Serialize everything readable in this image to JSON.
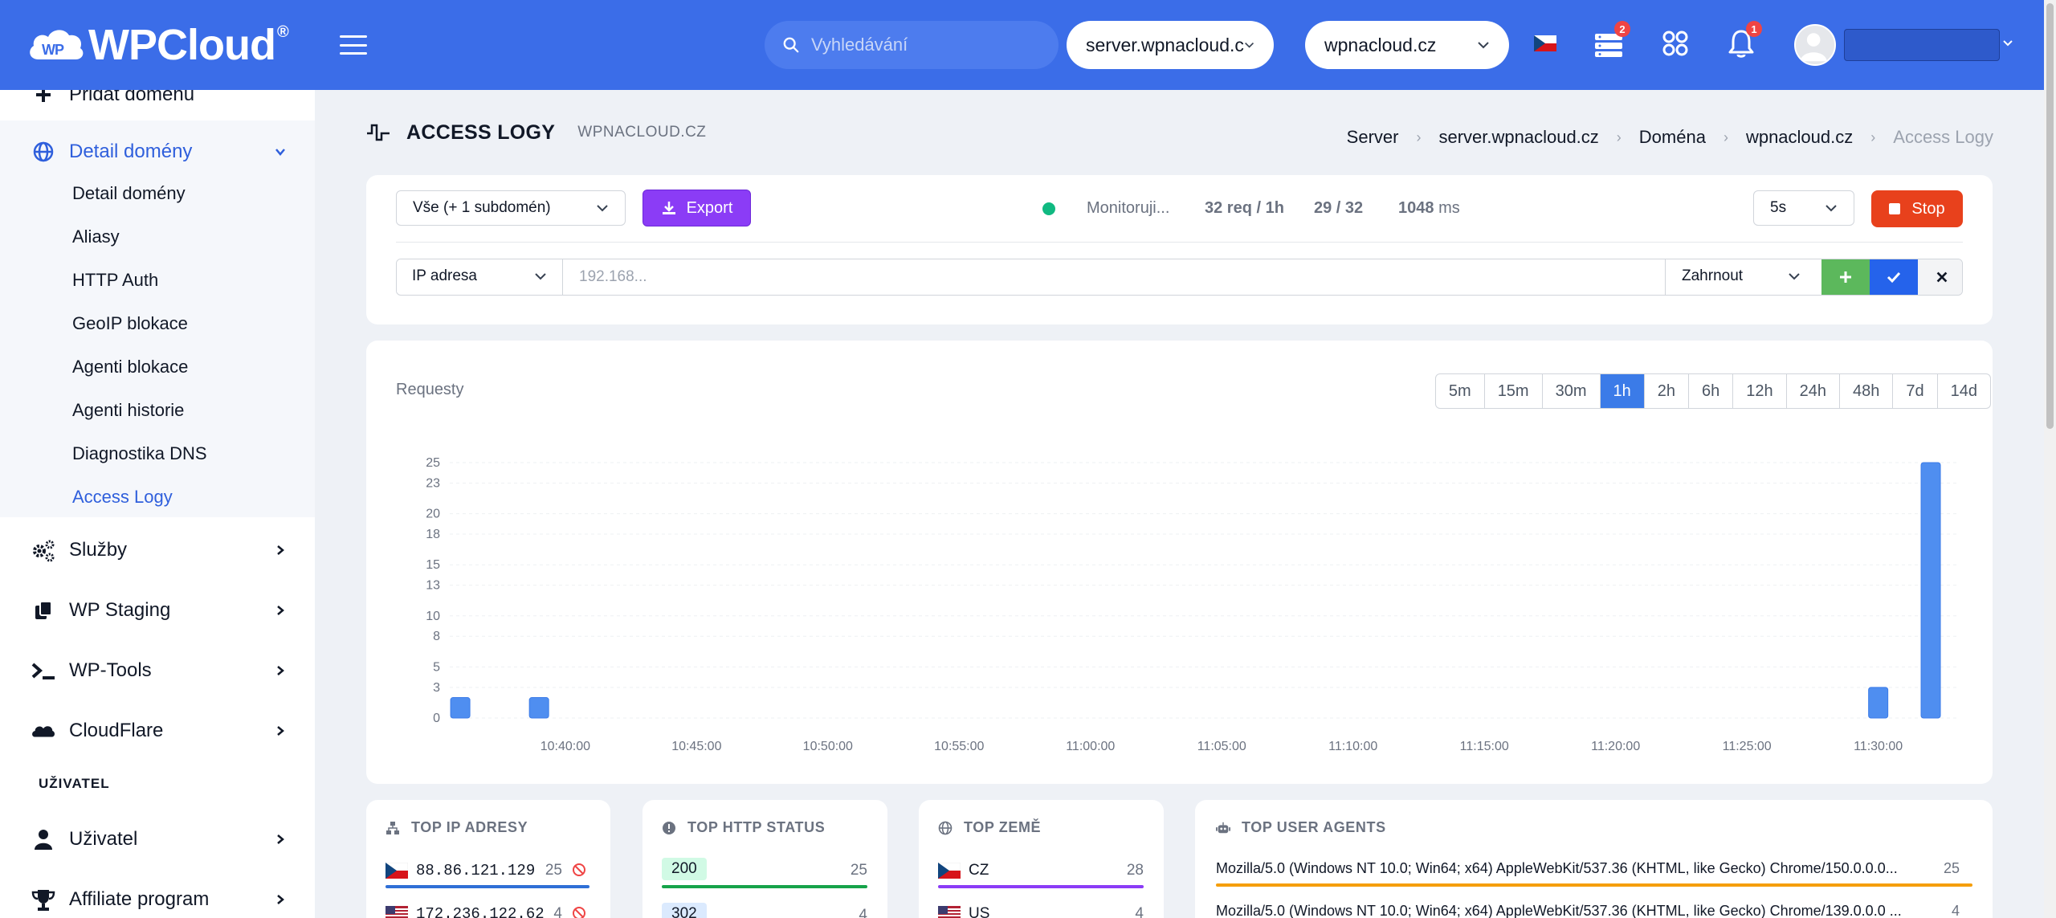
{
  "brand": {
    "name": "WPCloud",
    "reg": "®"
  },
  "header": {
    "search_placeholder": "Vyhledávání",
    "server_select": "server.wpnacloud.c",
    "domain_select": "wpnacloud.cz",
    "servers_badge": "2",
    "notifications_badge": "1",
    "accent_color": "#3b6de8"
  },
  "sidebar": {
    "top_partial_label": "Přidat doménu",
    "group_label": "Detail domény",
    "submenu": [
      "Detail domény",
      "Aliasy",
      "HTTP Auth",
      "GeoIP blokace",
      "Agenti blokace",
      "Agenti historie",
      "Diagnostika DNS",
      "Access Logy"
    ],
    "items": [
      {
        "label": "Služby",
        "icon": "gears-icon"
      },
      {
        "label": "WP Staging",
        "icon": "copy-icon"
      },
      {
        "label": "WP-Tools",
        "icon": "terminal-icon"
      },
      {
        "label": "CloudFlare",
        "icon": "cloud-icon"
      }
    ],
    "section_user": "UŽIVATEL",
    "user_items": [
      {
        "label": "Uživatel",
        "icon": "user-icon"
      },
      {
        "label": "Affiliate program",
        "icon": "trophy-icon"
      }
    ]
  },
  "page": {
    "title": "ACCESS LOGY",
    "subtitle": "WPNACLOUD.CZ",
    "breadcrumb": [
      "Server",
      "server.wpnacloud.cz",
      "Doména",
      "wpnacloud.cz",
      "Access Logy"
    ]
  },
  "controls": {
    "scope_select": "Vše (+ 1 subdomén)",
    "export_label": "Export",
    "monitoring_label": "Monitoruji...",
    "req_rate": "32 req / 1h",
    "ratio": "29 / 32",
    "latency_value": "1048",
    "latency_unit": "ms",
    "interval_select": "5s",
    "stop_label": "Stop",
    "filter_type": "IP adresa",
    "filter_placeholder": "192.168...",
    "filter_mode": "Zahrnout"
  },
  "chart_data": {
    "type": "bar",
    "title": "Requesty",
    "ranges": [
      "5m",
      "15m",
      "30m",
      "1h",
      "2h",
      "6h",
      "12h",
      "24h",
      "48h",
      "7d",
      "14d"
    ],
    "active_range": "1h",
    "y_ticks": [
      "0",
      "3",
      "5",
      "8",
      "10",
      "13",
      "15",
      "18",
      "20",
      "23",
      "25"
    ],
    "ylim": [
      0,
      25
    ],
    "x_ticks": [
      "10:40:00",
      "10:45:00",
      "10:50:00",
      "10:55:00",
      "11:00:00",
      "11:05:00",
      "11:10:00",
      "11:15:00",
      "11:20:00",
      "11:25:00",
      "11:30:00"
    ],
    "x_tick_minutes": [
      40,
      45,
      50,
      55,
      60,
      65,
      70,
      75,
      80,
      85,
      90
    ],
    "x_range_minutes": [
      35.6,
      93.1
    ],
    "bars": [
      {
        "minute": 36,
        "value": 2
      },
      {
        "minute": 39,
        "value": 2
      },
      {
        "minute": 90,
        "value": 3
      },
      {
        "minute": 92,
        "value": 25
      }
    ],
    "bar_color": "#4f8ef0",
    "grid": true
  },
  "top_ip": {
    "title": "TOP IP ADRESY",
    "rows": [
      {
        "ip": "88.86.121.129",
        "count": "25",
        "flag": "CZ"
      },
      {
        "ip": "172.236.122.62",
        "count": "4",
        "flag": "US"
      }
    ]
  },
  "top_status": {
    "title": "TOP HTTP STATUS",
    "rows": [
      {
        "code": "200",
        "count": "25"
      },
      {
        "code": "302",
        "count": "4"
      }
    ]
  },
  "top_country": {
    "title": "TOP ZEMĚ",
    "rows": [
      {
        "code": "CZ",
        "count": "28"
      },
      {
        "code": "US",
        "count": "4"
      }
    ]
  },
  "top_agents": {
    "title": "TOP USER AGENTS",
    "rows": [
      {
        "agent": "Mozilla/5.0 (Windows NT 10.0; Win64; x64) AppleWebKit/537.36 (KHTML, like Gecko) Chrome/150.0.0.0...",
        "count": "25"
      },
      {
        "agent": "Mozilla/5.0 (Windows NT 10.0; Win64; x64) AppleWebKit/537.36 (KHTML, like Gecko) Chrome/139.0.0.0 ...",
        "count": "4"
      }
    ]
  }
}
